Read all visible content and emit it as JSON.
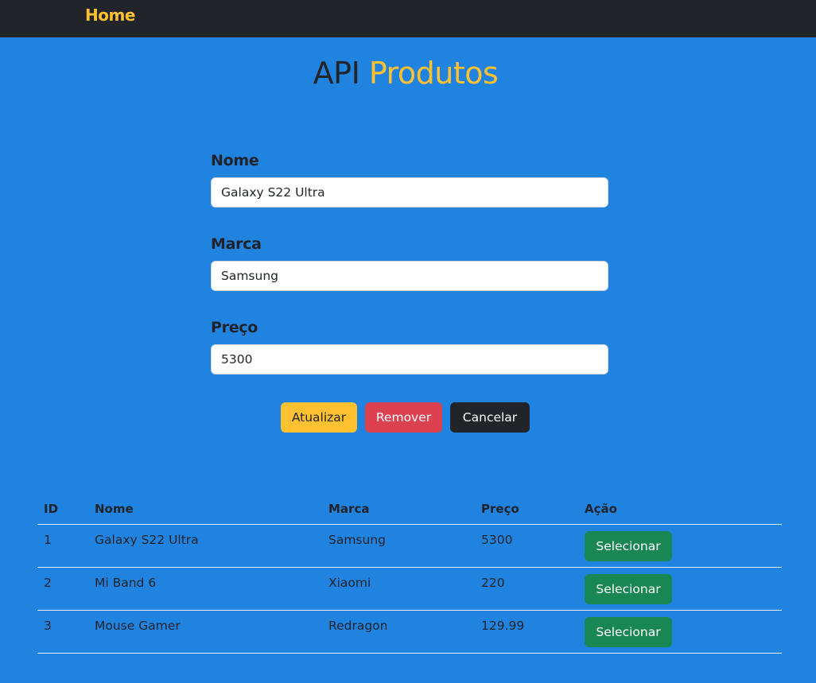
{
  "navbar": {
    "brand": "Home"
  },
  "title": {
    "part1": "API",
    "part2": "Produtos"
  },
  "form": {
    "nome": {
      "label": "Nome",
      "value": "Galaxy S22 Ultra"
    },
    "marca": {
      "label": "Marca",
      "value": "Samsung"
    },
    "preco": {
      "label": "Preço",
      "value": "5300"
    }
  },
  "buttons": {
    "atualizar": "Atualizar",
    "remover": "Remover",
    "cancelar": "Cancelar"
  },
  "table": {
    "headers": {
      "id": "ID",
      "nome": "Nome",
      "marca": "Marca",
      "preco": "Preço",
      "acao": "Ação"
    },
    "rows": [
      {
        "id": "1",
        "nome": "Galaxy S22 Ultra",
        "marca": "Samsung",
        "preco": "5300",
        "action": "Selecionar"
      },
      {
        "id": "2",
        "nome": "Mi Band 6",
        "marca": "Xiaomi",
        "preco": "220",
        "action": "Selecionar"
      },
      {
        "id": "3",
        "nome": "Mouse Gamer",
        "marca": "Redragon",
        "preco": "129.99",
        "action": "Selecionar"
      }
    ]
  },
  "colors": {
    "background": "#2183e0",
    "navbar": "#212529",
    "accent": "#ffc12f",
    "danger": "#dc4150",
    "success": "#198754"
  }
}
